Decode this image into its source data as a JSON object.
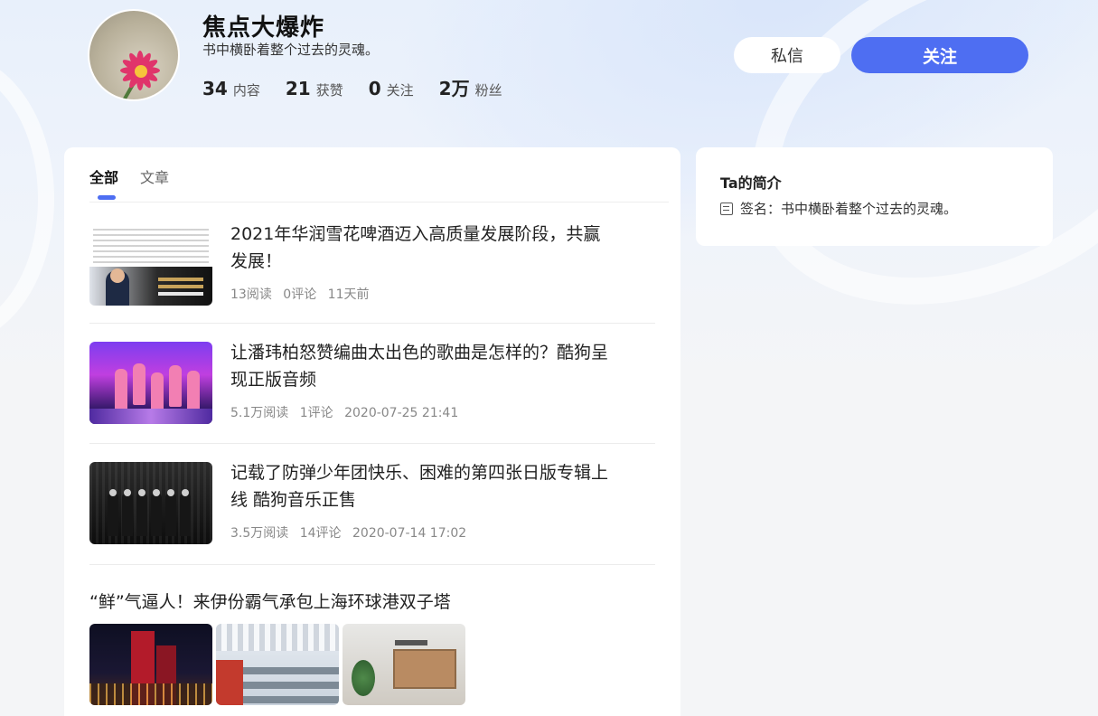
{
  "profile": {
    "name": "焦点大爆炸",
    "signature": "书中横卧着整个过去的灵魂。",
    "stats": [
      {
        "value": "34",
        "label": "内容"
      },
      {
        "value": "21",
        "label": "获赞"
      },
      {
        "value": "0",
        "label": "关注"
      },
      {
        "value": "2万",
        "label": "粉丝"
      }
    ],
    "message_button": "私信",
    "follow_button": "关注"
  },
  "tabs": [
    {
      "label": "全部",
      "active": true
    },
    {
      "label": "文章",
      "active": false
    }
  ],
  "articles": [
    {
      "title": "2021年华润雪花啤酒迈入高质量发展阶段，共赢发展！",
      "reads": "13阅读",
      "comments": "0评论",
      "time": "11天前"
    },
    {
      "title": "让潘玮柏怒赞编曲太出色的歌曲是怎样的？酷狗呈现正版音频",
      "reads": "5.1万阅读",
      "comments": "1评论",
      "time": "2020-07-25 21:41"
    },
    {
      "title": "记载了防弹少年团快乐、困难的第四张日版专辑上线 酷狗音乐正售",
      "reads": "3.5万阅读",
      "comments": "14评论",
      "time": "2020-07-14 17:02"
    }
  ],
  "gallery_post": {
    "title": "“鲜”气逼人！来伊份霸气承包上海环球港双子塔"
  },
  "sidebar": {
    "title": "Ta的简介",
    "signature_label": "签名：",
    "signature_value": "书中横卧着整个过去的灵魂。"
  },
  "colors": {
    "accent": "#4e6ef2",
    "background": "#f4f5f7"
  }
}
